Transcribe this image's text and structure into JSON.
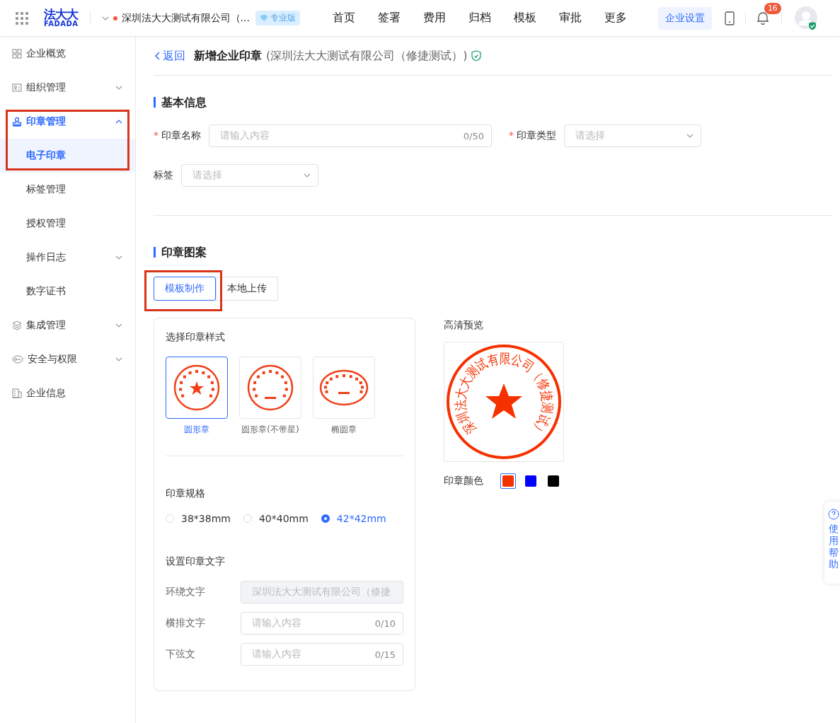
{
  "topbar": {
    "brand_cn": "法大大",
    "brand_en": "FADADA",
    "company": "深圳法大大测试有限公司（...",
    "edition": "专业版",
    "nav": [
      {
        "label": "首页"
      },
      {
        "label": "签署"
      },
      {
        "label": "费用"
      },
      {
        "label": "归档"
      },
      {
        "label": "模板"
      },
      {
        "label": "审批"
      },
      {
        "label": "更多"
      }
    ],
    "settings_button": "企业设置",
    "notification_count": "16"
  },
  "sidebar": {
    "items": [
      {
        "label": "企业概览",
        "kind": "link"
      },
      {
        "label": "组织管理",
        "kind": "group",
        "expanded": false
      },
      {
        "label": "印章管理",
        "kind": "group",
        "expanded": true,
        "highlighted": true,
        "children": [
          {
            "label": "电子印章",
            "kind": "link",
            "selected": true
          },
          {
            "label": "标签管理",
            "kind": "link",
            "selected": false
          },
          {
            "label": "授权管理",
            "kind": "link",
            "selected": false
          },
          {
            "label": "操作日志",
            "kind": "group",
            "expanded": false,
            "selected": false
          },
          {
            "label": "数字证书",
            "kind": "link",
            "selected": false
          }
        ]
      },
      {
        "label": "集成管理",
        "kind": "group",
        "expanded": false
      },
      {
        "label": "安全与权限",
        "kind": "group",
        "expanded": false
      },
      {
        "label": "企业信息",
        "kind": "link"
      }
    ]
  },
  "header": {
    "back": "返回",
    "title": "新增企业印章",
    "subtitle": "(深圳法大大测试有限公司（修捷测试）)"
  },
  "basic_info": {
    "title": "基本信息",
    "fields": [
      {
        "label": "印章名称",
        "kind": "text",
        "required_mark": "*",
        "placeholder": "请输入内容",
        "counter": "0/50"
      },
      {
        "label": "印章类型",
        "kind": "select",
        "required_mark": "*",
        "placeholder": "请选择"
      },
      {
        "label": "标签",
        "kind": "select",
        "placeholder": "请选择"
      }
    ]
  },
  "pattern": {
    "title": "印章图案",
    "tabs": [
      {
        "label": "模板制作",
        "selected": true,
        "highlighted": true
      },
      {
        "label": "本地上传",
        "selected": false,
        "highlighted": false
      }
    ],
    "style_title": "选择印章样式",
    "styles": [
      {
        "label": "圆形章",
        "kind": "star",
        "selected": true
      },
      {
        "label": "圆形章(不带星)",
        "kind": "circle",
        "selected": false
      },
      {
        "label": "椭圆章",
        "kind": "oval",
        "selected": false
      }
    ],
    "size_title": "印章规格",
    "sizes": [
      {
        "label": "38*38mm",
        "selected": false
      },
      {
        "label": "40*40mm",
        "selected": false
      },
      {
        "label": "42*42mm",
        "selected": true
      }
    ],
    "text_title": "设置印章文字",
    "text_fields": [
      {
        "label": "环绕文字",
        "disabled": true,
        "value": "深圳法大大测试有限公司（修捷"
      },
      {
        "label": "横排文字",
        "disabled": false,
        "placeholder": "请输入内容",
        "counter": "0/10"
      },
      {
        "label": "下弦文",
        "disabled": false,
        "placeholder": "请输入内容",
        "counter": "0/15"
      }
    ],
    "preview_title": "高清预览",
    "preview_ring_text": "深圳法大大测试有限公司（修捷测试）",
    "color_label": "印章颜色",
    "colors": [
      {
        "color": "#f53100",
        "selected": true
      },
      {
        "color": "#0000ff",
        "selected": false
      },
      {
        "color": "#000000",
        "selected": false
      }
    ]
  },
  "help": {
    "label": "使用帮助"
  }
}
